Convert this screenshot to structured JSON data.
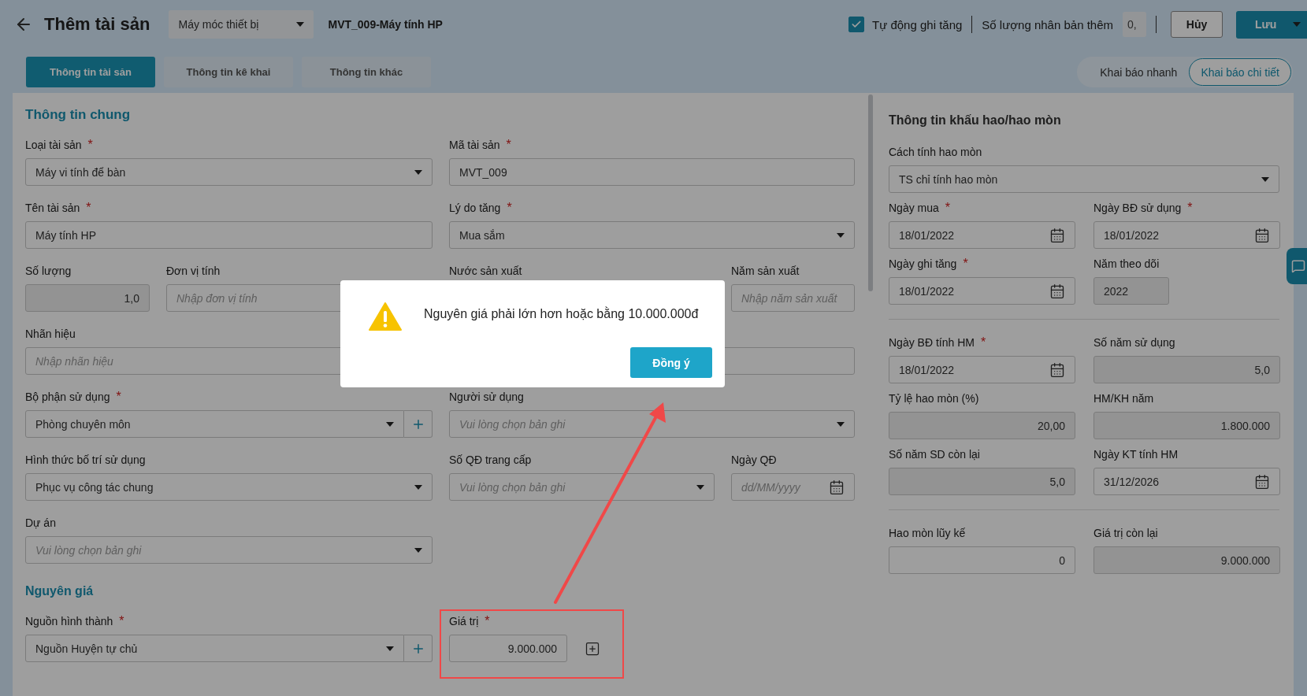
{
  "header": {
    "title": "Thêm tài sản",
    "type_select": "Máy móc thiết bị",
    "asset_code": "MVT_009-Máy tính HP",
    "auto_increase": {
      "label": "Tự động ghi tăng",
      "checked": true
    },
    "copies": {
      "label": "Số lượng nhân bản thêm",
      "value": "0,"
    },
    "cancel": "Hủy",
    "save": "Lưu"
  },
  "tabs": [
    {
      "label": "Thông tin tài sản",
      "selected": true
    },
    {
      "label": "Thông tin kê khai",
      "selected": false
    },
    {
      "label": "Thông tin khác",
      "selected": false
    }
  ],
  "modes": [
    {
      "label": "Khai báo nhanh",
      "selected": false
    },
    {
      "label": "Khai báo chi tiết",
      "selected": true
    }
  ],
  "general": {
    "title": "Thông tin chung",
    "rows": [
      [
        {
          "label": "Loại tài sản",
          "mark": "*",
          "kind": "select",
          "value": "Máy vi tính để bàn"
        },
        {
          "label": "Mã tài sản",
          "mark": "*",
          "kind": "text",
          "value": "MVT_009"
        }
      ],
      [
        {
          "label": "Tên tài sản",
          "mark": "*",
          "kind": "text",
          "value": "Máy tính HP"
        },
        {
          "label": "Lý do tăng",
          "mark": "*",
          "kind": "select",
          "value": "Mua sắm"
        }
      ],
      [
        {
          "kind": "pair",
          "fields": [
            {
              "label": "Số lượng",
              "kind": "readonly",
              "value": "1,0"
            },
            {
              "label": "Đơn vị tính",
              "kind": "text",
              "placeholder": "Nhập đơn vị tính"
            }
          ]
        },
        {
          "label": "Nước sản xuất"
        },
        {
          "label": "Năm sản xuất",
          "kind": "text",
          "placeholder": "Nhập năm sản xuất"
        }
      ],
      [
        {
          "label": "Nhãn hiệu",
          "kind": "text",
          "placeholder": "Nhập nhãn hiệu"
        },
        {
          "kind": "text"
        }
      ],
      [
        {
          "label": "Bộ phận sử dụng",
          "mark": "*",
          "kind": "select-add",
          "value": "Phòng chuyên môn"
        },
        {
          "label": "Người sử dụng",
          "kind": "select",
          "placeholder": "Vui lòng chọn bản ghi"
        }
      ],
      [
        {
          "label": "Hình thức bố trí sử dụng",
          "kind": "select",
          "value": "Phục vụ công tác chung"
        },
        {
          "label": "Số QĐ trang cấp",
          "kind": "select",
          "placeholder": "Vui lòng chọn bản ghi"
        },
        {
          "label": "Ngày QĐ",
          "kind": "date",
          "placeholder": "dd/MM/yyyy"
        }
      ],
      [
        {
          "label": "Dự án",
          "kind": "select",
          "placeholder": "Vui lòng chọn bản ghi"
        }
      ]
    ]
  },
  "cost": {
    "title": "Nguyên giá",
    "rows": [
      [
        {
          "label": "Nguồn hình thành",
          "mark": "*",
          "kind": "select-add",
          "value": "Nguồn Huyện tự chủ"
        },
        {
          "label": "Giá trị",
          "mark": "*",
          "kind": "money-add",
          "value": "9.000.000"
        }
      ]
    ]
  },
  "depreciation": {
    "title": "Thông tin khấu hao/hao mòn",
    "method": {
      "label": "Cách tính hao mòn",
      "kind": "select",
      "value": "TS chỉ tính hao mòn"
    },
    "groups": [
      [
        {
          "label": "Ngày mua",
          "mark": "*",
          "kind": "date",
          "value": "18/01/2022"
        },
        {
          "label": "Ngày BĐ sử dụng",
          "mark": "*",
          "kind": "date",
          "value": "18/01/2022"
        },
        {
          "label": "Ngày ghi tăng",
          "mark": "*",
          "kind": "date",
          "value": "18/01/2022"
        },
        {
          "label": "Năm theo dõi",
          "kind": "year",
          "value": "2022"
        }
      ],
      [
        {
          "label": "Ngày BĐ tính HM",
          "mark": "*",
          "kind": "date",
          "value": "18/01/2022"
        },
        {
          "label": "Số năm sử dụng",
          "kind": "readonly",
          "value": "5,0"
        },
        {
          "label": "Tỷ lệ hao mòn (%)",
          "kind": "readonly",
          "value": "20,00"
        },
        {
          "label": "HM/KH năm",
          "kind": "readonly",
          "value": "1.800.000"
        },
        {
          "label": "Số năm SD còn lại",
          "kind": "readonly",
          "value": "5,0"
        },
        {
          "label": "Ngày KT tính HM",
          "kind": "date",
          "value": "31/12/2026"
        }
      ],
      [
        {
          "label": "Hao mòn lũy kế",
          "kind": "number",
          "value": "0"
        },
        {
          "label": "Giá trị còn lại",
          "kind": "readonly",
          "value": "9.000.000"
        }
      ]
    ]
  },
  "dialog": {
    "message": "Nguyên giá phải lớn hơn hoặc bằng 10.000.000đ",
    "button": "Đồng ý"
  }
}
